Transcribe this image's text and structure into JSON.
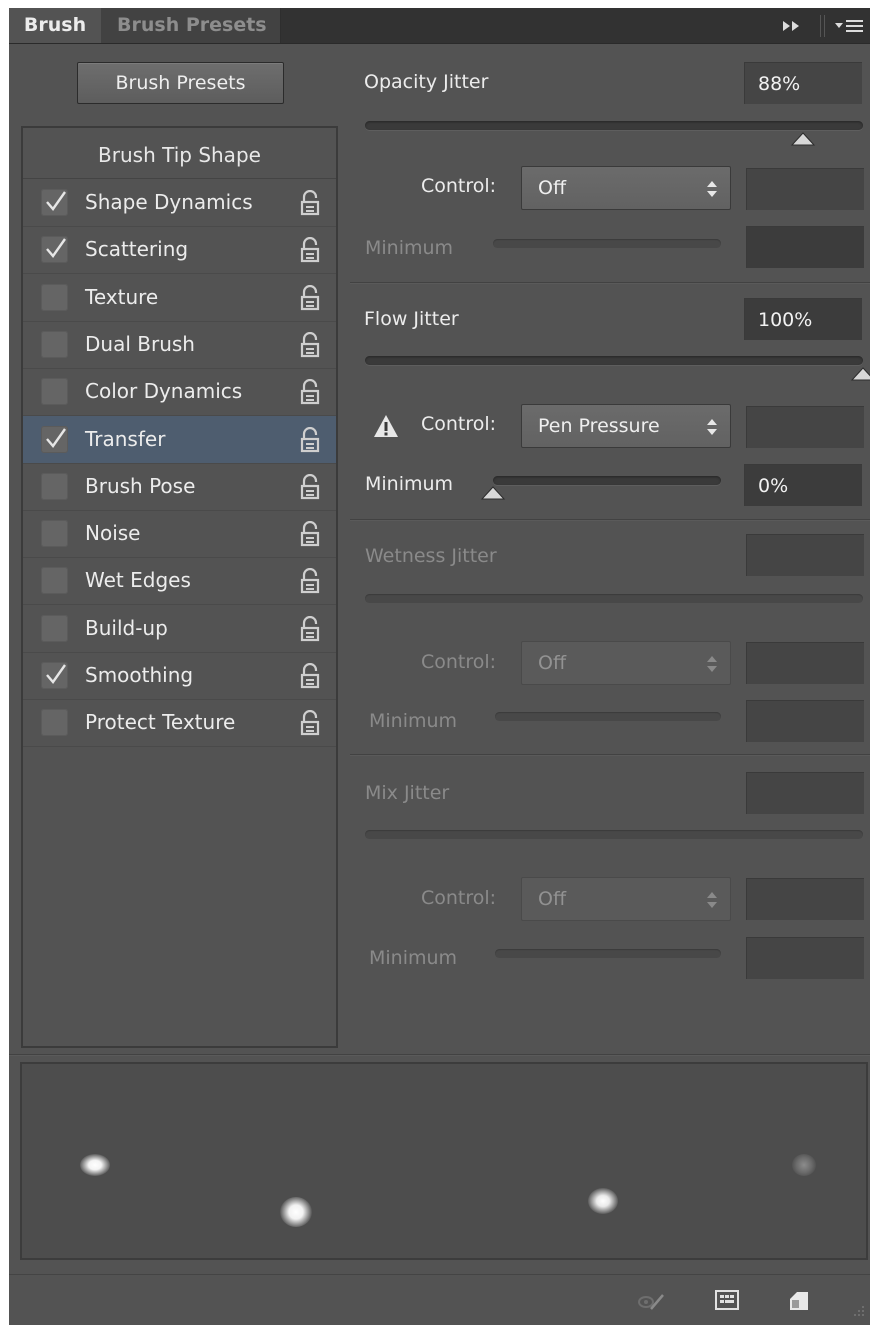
{
  "tabs": {
    "active": "Brush",
    "inactive": "Brush Presets"
  },
  "icons": {
    "collapse": "double-arrow-right-icon",
    "panel_menu": "panel-menu-icon",
    "lock": "lock-icon",
    "warning": "warning-triangle-icon",
    "toggle_live_tip": "brush-preview-toggle-icon",
    "grid": "grid-icon",
    "new_preset": "new-preset-icon"
  },
  "colors": {
    "panel_bg": "#535353",
    "selected_row": "#4e5d6f",
    "track": "#3a3a3a"
  },
  "presets_button": "Brush Presets",
  "options": {
    "tip_shape": "Brush Tip Shape",
    "items": [
      {
        "label": "Shape Dynamics",
        "checked": true,
        "selected": false
      },
      {
        "label": "Scattering",
        "checked": true,
        "selected": false
      },
      {
        "label": "Texture",
        "checked": false,
        "selected": false
      },
      {
        "label": "Dual Brush",
        "checked": false,
        "selected": false
      },
      {
        "label": "Color Dynamics",
        "checked": false,
        "selected": false
      },
      {
        "label": "Transfer",
        "checked": true,
        "selected": true
      },
      {
        "label": "Brush Pose",
        "checked": false,
        "selected": false
      },
      {
        "label": "Noise",
        "checked": false,
        "selected": false
      },
      {
        "label": "Wet Edges",
        "checked": false,
        "selected": false
      },
      {
        "label": "Build-up",
        "checked": false,
        "selected": false
      },
      {
        "label": "Smoothing",
        "checked": true,
        "selected": false
      },
      {
        "label": "Protect Texture",
        "checked": false,
        "selected": false
      }
    ]
  },
  "opacity": {
    "label": "Opacity Jitter",
    "value": "88%",
    "level": 0.88,
    "control_label": "Control:",
    "control_value": "Off",
    "minimum_label": "Minimum",
    "minimum_value": ""
  },
  "flow": {
    "label": "Flow Jitter",
    "value": "100%",
    "level": 1.0,
    "control_label": "Control:",
    "control_value": "Pen Pressure",
    "minimum_label": "Minimum",
    "minimum_value": "0%",
    "minimum_level": 0.0
  },
  "wetness": {
    "label": "Wetness Jitter",
    "value": "",
    "control_label": "Control:",
    "control_value": "Off",
    "minimum_label": "Minimum",
    "minimum_value": ""
  },
  "mix": {
    "label": "Mix Jitter",
    "value": "",
    "control_label": "Control:",
    "control_value": "Off",
    "minimum_label": "Minimum",
    "minimum_value": ""
  }
}
